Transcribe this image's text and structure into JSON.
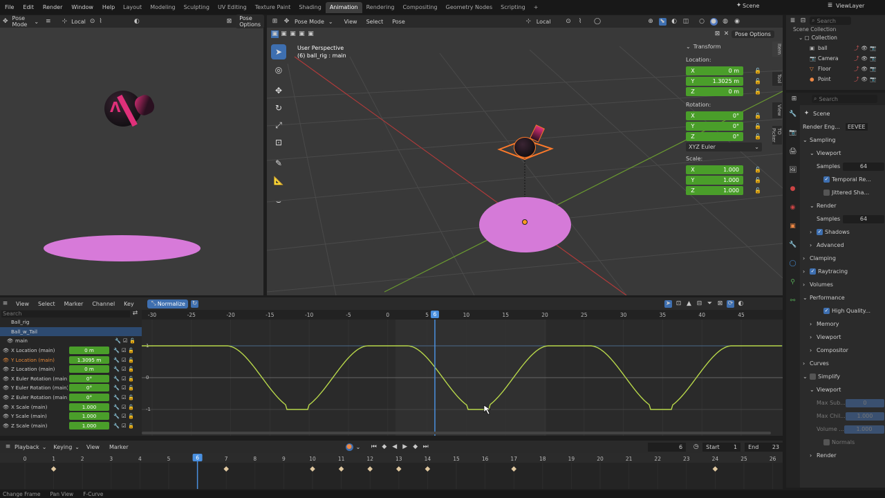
{
  "topbar": {
    "menus": [
      "File",
      "Edit",
      "Render",
      "Window",
      "Help"
    ],
    "workspaces": [
      "Layout",
      "Modeling",
      "Sculpting",
      "UV Editing",
      "Texture Paint",
      "Shading",
      "Animation",
      "Rendering",
      "Compositing",
      "Geometry Nodes",
      "Scripting"
    ],
    "active_workspace": "Animation",
    "scene": "Scene",
    "viewlayer": "ViewLayer"
  },
  "left_view": {
    "mode": "Pose Mode",
    "orient": "Local",
    "pose_options": "Pose Options"
  },
  "viewport": {
    "mode": "Pose Mode",
    "menus": [
      "View",
      "Select",
      "Pose"
    ],
    "orient": "Local",
    "pose_options": "Pose Options",
    "perspective": "User Perspective",
    "object_label": "(6) ball_rig : main"
  },
  "transform": {
    "title": "Transform",
    "location_label": "Location:",
    "location": [
      {
        "axis": "X",
        "value": "0 m"
      },
      {
        "axis": "Y",
        "value": "1.3025 m"
      },
      {
        "axis": "Z",
        "value": "0 m"
      }
    ],
    "rotation_label": "Rotation:",
    "rotation": [
      {
        "axis": "X",
        "value": "0°"
      },
      {
        "axis": "Y",
        "value": "0°"
      },
      {
        "axis": "Z",
        "value": "0°"
      }
    ],
    "rotation_mode": "XYZ Euler",
    "scale_label": "Scale:",
    "scale": [
      {
        "axis": "X",
        "value": "1.000"
      },
      {
        "axis": "Y",
        "value": "1.000"
      },
      {
        "axis": "Z",
        "value": "1.000"
      }
    ]
  },
  "side_tabs": [
    "Item",
    "Tool",
    "View",
    "TO Picker"
  ],
  "outliner": {
    "root": "Scene Collection",
    "collection": "Collection",
    "items": [
      "ball",
      "Camera",
      "Floor",
      "Point"
    ],
    "search_placeholder": "Search"
  },
  "properties": {
    "search_placeholder": "Search",
    "scene": "Scene",
    "render_engine_label": "Render Eng...",
    "render_engine": "EEVEE",
    "rows": [
      {
        "t": "Sampling",
        "ind": 0,
        "arrow": "v"
      },
      {
        "t": "Viewport",
        "ind": 1,
        "arrow": "v"
      },
      {
        "t": "Samples",
        "ind": 2,
        "field": "64"
      },
      {
        "t": "Temporal Re...",
        "ind": 3,
        "check": true
      },
      {
        "t": "Jittered Sha...",
        "ind": 3,
        "check": false
      },
      {
        "t": "Render",
        "ind": 1,
        "arrow": "v"
      },
      {
        "t": "Samples",
        "ind": 2,
        "field": "64"
      },
      {
        "t": "Shadows",
        "ind": 1,
        "arrow": ">",
        "check": true
      },
      {
        "t": "Advanced",
        "ind": 1,
        "arrow": ">"
      },
      {
        "t": "Clamping",
        "ind": 0,
        "arrow": ">"
      },
      {
        "t": "Raytracing",
        "ind": 0,
        "arrow": ">",
        "check": true
      },
      {
        "t": "Volumes",
        "ind": 0,
        "arrow": ">"
      },
      {
        "t": "Performance",
        "ind": 0,
        "arrow": "v"
      },
      {
        "t": "High Quality...",
        "ind": 3,
        "check": true
      },
      {
        "t": "Memory",
        "ind": 1,
        "arrow": ">"
      },
      {
        "t": "Viewport",
        "ind": 1,
        "arrow": ">"
      },
      {
        "t": "Compositor",
        "ind": 1,
        "arrow": ">"
      },
      {
        "t": "Curves",
        "ind": 0,
        "arrow": ">"
      },
      {
        "t": "Simplify",
        "ind": 0,
        "arrow": "v",
        "check": false
      },
      {
        "t": "Viewport",
        "ind": 1,
        "arrow": "v"
      },
      {
        "t": "Max Sub...",
        "ind": 2,
        "field": "0",
        "dim": true
      },
      {
        "t": "Max Chil...",
        "ind": 2,
        "field": "1.000",
        "dim": true
      },
      {
        "t": "Volume ...",
        "ind": 2,
        "field": "1.000",
        "dim": true
      },
      {
        "t": "Normals",
        "ind": 3,
        "check": false,
        "dim": true
      },
      {
        "t": "Render",
        "ind": 1,
        "arrow": ">"
      }
    ]
  },
  "graph": {
    "menus": [
      "View",
      "Select",
      "Marker",
      "Channel",
      "Key"
    ],
    "normalize": "Normalize",
    "search_placeholder": "Search",
    "channels": [
      {
        "name": "Ball_rig",
        "value": ""
      },
      {
        "name": "Ball_w_Tail",
        "value": ""
      },
      {
        "name": "main",
        "value": ""
      },
      {
        "name": "X Location (main)",
        "value": "0 m"
      },
      {
        "name": "Y Location (main)",
        "value": "1.3095 m",
        "active": true
      },
      {
        "name": "Z Location (main)",
        "value": "0 m"
      },
      {
        "name": "X Euler Rotation (main)",
        "value": "0°"
      },
      {
        "name": "Y Euler Rotation (main)",
        "value": "0°"
      },
      {
        "name": "Z Euler Rotation (main)",
        "value": "0°"
      },
      {
        "name": "X Scale (main)",
        "value": "1.000"
      },
      {
        "name": "Y Scale (main)",
        "value": "1.000"
      },
      {
        "name": "Z Scale (main)",
        "value": "1.000"
      }
    ],
    "ruler": [
      "-30",
      "-25",
      "-20",
      "-15",
      "-10",
      "-5",
      "0",
      "5",
      "10",
      "15",
      "20",
      "25",
      "30",
      "35",
      "40",
      "45"
    ],
    "current_frame": "6",
    "y_labels": [
      "1",
      "0",
      "-1"
    ]
  },
  "timeline": {
    "menus": [
      "Playback",
      "Keying",
      "View",
      "Marker"
    ],
    "frame": "6",
    "start_label": "Start",
    "start": "1",
    "end_label": "End",
    "end": "23",
    "ruler": [
      "0",
      "1",
      "2",
      "3",
      "4",
      "5",
      "6",
      "7",
      "8",
      "9",
      "10",
      "11",
      "12",
      "13",
      "14",
      "15",
      "16",
      "17",
      "18",
      "19",
      "20",
      "21",
      "22",
      "23",
      "24",
      "25",
      "26"
    ],
    "keyframes": [
      1,
      7,
      10,
      11,
      12,
      13,
      14,
      17,
      24
    ]
  },
  "status": [
    "Change Frame",
    "Pan View",
    "F-Curve"
  ]
}
